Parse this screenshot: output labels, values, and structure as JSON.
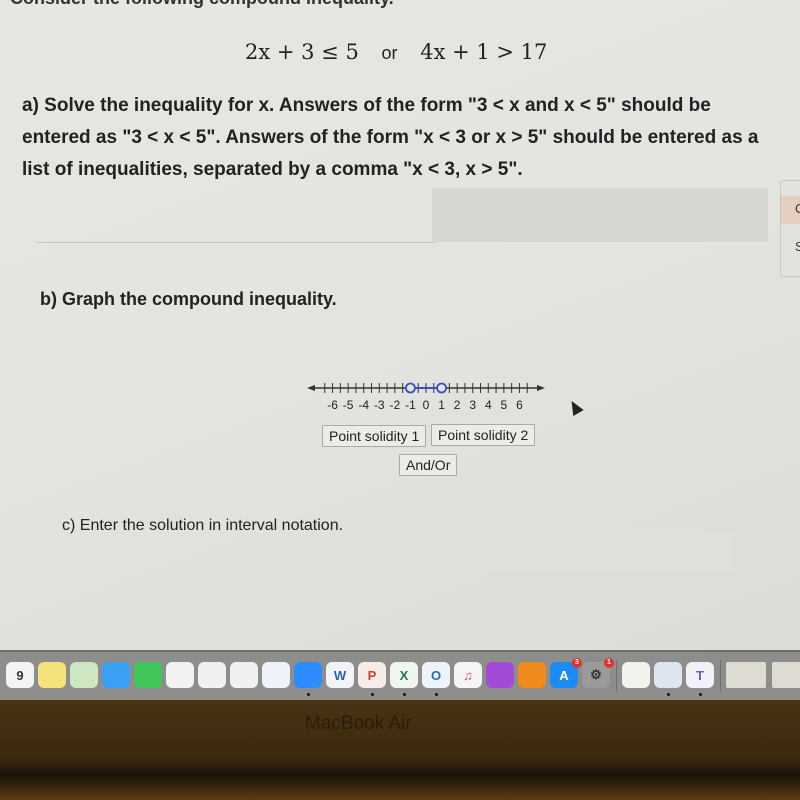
{
  "page": {
    "header_text": "Consider the following compound inequality.",
    "equation": {
      "left": "2x + 3 ≤ 5",
      "connector": "or",
      "right": "4x + 1 > 17"
    },
    "part_a": {
      "text": "a) Solve the inequality for x. Answers of the form \"3 < x and x < 5\" should be entered as \"3 < x < 5\". Answers of the form \"x < 3 or x > 5\" should be entered as a list of inequalities, separated by a comma \"x < 3, x > 5\".",
      "answer_value": ""
    },
    "side_panel": {
      "label_1": "C",
      "label_2": "S"
    },
    "part_b": {
      "text": "b) Graph the compound inequality.",
      "number_line": {
        "ticks": [
          "-6",
          "-5",
          "-4",
          "-3",
          "-2",
          "-1",
          "0",
          "1",
          "2",
          "3",
          "4",
          "5",
          "6"
        ],
        "min": -7,
        "max": 7,
        "points": [
          {
            "value": -1,
            "style": "open"
          },
          {
            "value": 1,
            "style": "open"
          }
        ],
        "segment": {
          "from": -1,
          "to": 1
        },
        "accent_color": "#3a4fc4"
      },
      "buttons": {
        "point_solidity_1": "Point solidity 1",
        "point_solidity_2": "Point solidity 2",
        "and_or": "And/Or"
      }
    },
    "part_c": {
      "text": "c) Enter the solution in interval notation.",
      "answer_value": ""
    }
  },
  "dock": {
    "items": [
      {
        "name": "calendar",
        "label": "9"
      },
      {
        "name": "notes",
        "label": ""
      },
      {
        "name": "maps",
        "label": ""
      },
      {
        "name": "messages",
        "label": ""
      },
      {
        "name": "facetime",
        "label": ""
      },
      {
        "name": "photos",
        "label": ""
      },
      {
        "name": "script-editor",
        "label": ""
      },
      {
        "name": "numbers",
        "label": ""
      },
      {
        "name": "keynote",
        "label": ""
      },
      {
        "name": "zoom",
        "label": ""
      },
      {
        "name": "word",
        "label": "W"
      },
      {
        "name": "powerpoint",
        "label": "P"
      },
      {
        "name": "excel",
        "label": "X"
      },
      {
        "name": "outlook",
        "label": "O"
      },
      {
        "name": "music",
        "label": "♫"
      },
      {
        "name": "podcasts",
        "label": ""
      },
      {
        "name": "books",
        "label": ""
      },
      {
        "name": "app-store",
        "label": "A",
        "badge": "3"
      },
      {
        "name": "system-preferences",
        "label": "⚙",
        "badge": "1"
      },
      {
        "name": "textedit",
        "label": ""
      },
      {
        "name": "preview",
        "label": ""
      },
      {
        "name": "teams",
        "label": "T"
      },
      {
        "name": "window-thumb-1",
        "label": ""
      },
      {
        "name": "window-thumb-2",
        "label": ""
      }
    ]
  },
  "hardware": {
    "brand": "MacBook Air"
  }
}
